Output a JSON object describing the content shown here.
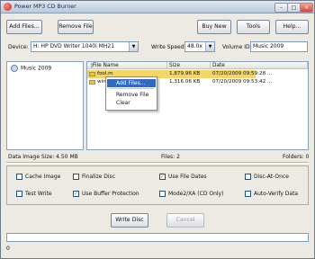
{
  "window": {
    "title": "Power MP3 CD Burner",
    "minimize": "–",
    "maximize": "□",
    "close": "×"
  },
  "toolbar": {
    "add_files": "Add Files...",
    "remove_file": "Remove File",
    "buy_now": "Buy New",
    "tools": "Tools",
    "help": "Help..."
  },
  "device": {
    "label": "Device:",
    "value": "H: HP DVD Writer 1040i MH21",
    "write_speed_label": "Write Speed:",
    "write_speed_value": "48.0x",
    "volume_label": "Volume ID:",
    "volume_value": "Music 2009"
  },
  "tree": {
    "root": "Music 2009"
  },
  "file_list": {
    "columns": [
      "File Name",
      "Size",
      "Date"
    ],
    "rows": [
      {
        "name": "fool.m",
        "size": "1,879.96 KB",
        "date": "07/20/2009 09:59:28 ...",
        "selected": true
      },
      {
        "name": "win.m",
        "size": "1,316.06 KB",
        "date": "07/20/2009 09:53:42 ...",
        "selected": false
      }
    ]
  },
  "context_menu": {
    "items": [
      "Add Files...",
      "Remove File",
      "Clear"
    ],
    "highlighted": 0
  },
  "status": {
    "data_image_size": "Data Image Size: 4.50 MB",
    "files": "Files: 2",
    "folders": "Folders: 0"
  },
  "options": [
    {
      "label": "Cache Image",
      "checked": false
    },
    {
      "label": "Finalize Disc",
      "checked": false
    },
    {
      "label": "Use File Dates",
      "checked": true
    },
    {
      "label": "Disc-At-Once",
      "checked": false
    },
    {
      "label": "Test Write",
      "checked": false
    },
    {
      "label": "Use Buffer Protection",
      "checked": true
    },
    {
      "label": "Mode2/XA (CD Only)",
      "checked": false
    },
    {
      "label": "Auto-Verify Data",
      "checked": false
    }
  ],
  "actions": {
    "write_disc": "Write Disc",
    "cancel": "Cancel"
  },
  "progress": {
    "value_percent": 0,
    "label": "0"
  },
  "colors": {
    "accent": "#316ac5",
    "selected_row": "#f6d568",
    "check": "#21a121"
  }
}
